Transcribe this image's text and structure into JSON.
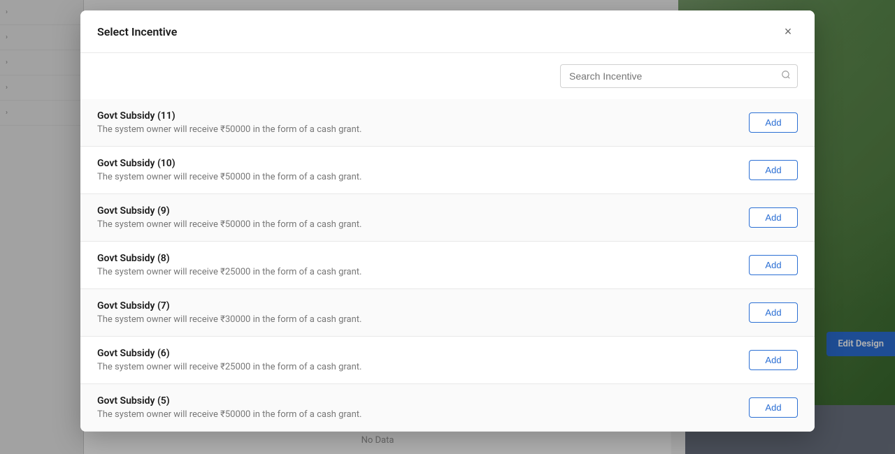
{
  "background": {
    "no_data_label": "No Data",
    "edit_design_label": "Edit Design"
  },
  "modal": {
    "title": "Select Incentive",
    "close_label": "×",
    "search": {
      "placeholder": "Search Incentive"
    },
    "incentives": [
      {
        "id": 1,
        "name": "Govt Subsidy (11)",
        "description": "The system owner will receive ₹50000 in the form of a cash grant.",
        "add_label": "Add"
      },
      {
        "id": 2,
        "name": "Govt Subsidy (10)",
        "description": "The system owner will receive ₹50000 in the form of a cash grant.",
        "add_label": "Add"
      },
      {
        "id": 3,
        "name": "Govt Subsidy (9)",
        "description": "The system owner will receive ₹50000 in the form of a cash grant.",
        "add_label": "Add"
      },
      {
        "id": 4,
        "name": "Govt Subsidy (8)",
        "description": "The system owner will receive ₹25000 in the form of a cash grant.",
        "add_label": "Add"
      },
      {
        "id": 5,
        "name": "Govt Subsidy (7)",
        "description": "The system owner will receive ₹30000 in the form of a cash grant.",
        "add_label": "Add"
      },
      {
        "id": 6,
        "name": "Govt Subsidy (6)",
        "description": "The system owner will receive ₹25000 in the form of a cash grant.",
        "add_label": "Add"
      },
      {
        "id": 7,
        "name": "Govt Subsidy (5)",
        "description": "The system owner will receive ₹50000 in the form of a cash grant.",
        "add_label": "Add"
      }
    ]
  }
}
